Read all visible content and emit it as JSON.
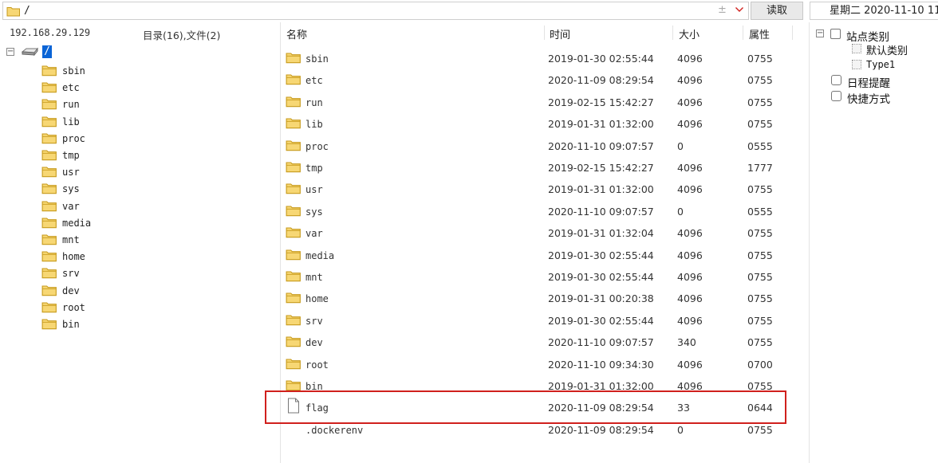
{
  "toolbar": {
    "path": "/",
    "plus_minus": "±",
    "read_label": "读取",
    "date_text": "星期二 2020-11-10 11:"
  },
  "left": {
    "host": "192.168.29.129",
    "summary": "目录(16),文件(2)",
    "root_label": "/",
    "tree": [
      "sbin",
      "etc",
      "run",
      "lib",
      "proc",
      "tmp",
      "usr",
      "sys",
      "var",
      "media",
      "mnt",
      "home",
      "srv",
      "dev",
      "root",
      "bin"
    ]
  },
  "list": {
    "columns": {
      "name": "名称",
      "time": "时间",
      "size": "大小",
      "attr": "属性"
    },
    "rows": [
      {
        "name": "sbin",
        "time": "2019-01-30 02:55:44",
        "size": "4096",
        "attr": "0755",
        "type": "folder"
      },
      {
        "name": "etc",
        "time": "2020-11-09 08:29:54",
        "size": "4096",
        "attr": "0755",
        "type": "folder"
      },
      {
        "name": "run",
        "time": "2019-02-15 15:42:27",
        "size": "4096",
        "attr": "0755",
        "type": "folder"
      },
      {
        "name": "lib",
        "time": "2019-01-31 01:32:00",
        "size": "4096",
        "attr": "0755",
        "type": "folder"
      },
      {
        "name": "proc",
        "time": "2020-11-10 09:07:57",
        "size": "0",
        "attr": "0555",
        "type": "folder"
      },
      {
        "name": "tmp",
        "time": "2019-02-15 15:42:27",
        "size": "4096",
        "attr": "1777",
        "type": "folder"
      },
      {
        "name": "usr",
        "time": "2019-01-31 01:32:00",
        "size": "4096",
        "attr": "0755",
        "type": "folder"
      },
      {
        "name": "sys",
        "time": "2020-11-10 09:07:57",
        "size": "0",
        "attr": "0555",
        "type": "folder"
      },
      {
        "name": "var",
        "time": "2019-01-31 01:32:04",
        "size": "4096",
        "attr": "0755",
        "type": "folder"
      },
      {
        "name": "media",
        "time": "2019-01-30 02:55:44",
        "size": "4096",
        "attr": "0755",
        "type": "folder"
      },
      {
        "name": "mnt",
        "time": "2019-01-30 02:55:44",
        "size": "4096",
        "attr": "0755",
        "type": "folder"
      },
      {
        "name": "home",
        "time": "2019-01-31 00:20:38",
        "size": "4096",
        "attr": "0755",
        "type": "folder"
      },
      {
        "name": "srv",
        "time": "2019-01-30 02:55:44",
        "size": "4096",
        "attr": "0755",
        "type": "folder"
      },
      {
        "name": "dev",
        "time": "2020-11-10 09:07:57",
        "size": "340",
        "attr": "0755",
        "type": "folder"
      },
      {
        "name": "root",
        "time": "2020-11-10 09:34:30",
        "size": "4096",
        "attr": "0700",
        "type": "folder"
      },
      {
        "name": "bin",
        "time": "2019-01-31 01:32:00",
        "size": "4096",
        "attr": "0755",
        "type": "folder"
      },
      {
        "name": "flag",
        "time": "2020-11-09 08:29:54",
        "size": "33",
        "attr": "0644",
        "type": "file"
      },
      {
        "name": ".dockerenv",
        "time": "2020-11-09 08:29:54",
        "size": "0",
        "attr": "0755",
        "type": "none"
      }
    ]
  },
  "right": {
    "sites_label": "站点类别",
    "site_children": [
      "默认类别",
      "Type1"
    ],
    "schedule_label": "日程提醒",
    "shortcut_label": "快捷方式"
  },
  "colors": {
    "folder_fill": "#f7d774",
    "folder_stroke": "#c79a1b",
    "selection": "#0a64d6",
    "highlight": "#d0201d"
  },
  "icons": {
    "folder": "folder-icon",
    "file": "file-icon",
    "drive": "drive-icon",
    "dropdown": "chevron-down-icon"
  }
}
